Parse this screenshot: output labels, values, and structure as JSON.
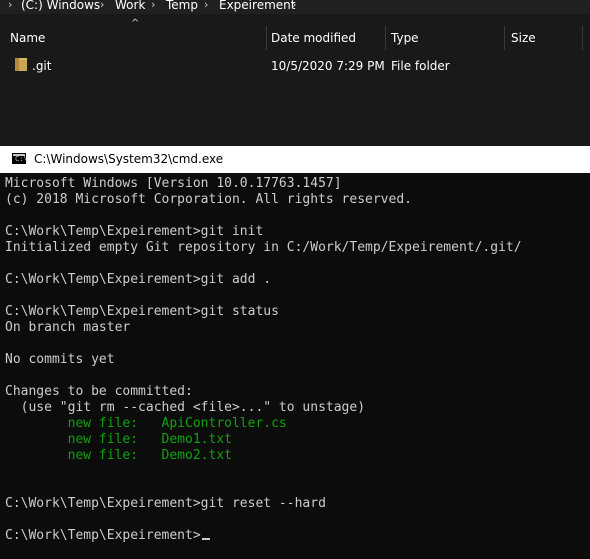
{
  "explorer": {
    "breadcrumb": [
      "(C:) Windows",
      "Work",
      "Temp",
      "Expeirement"
    ],
    "breadcrumb_separator": "›",
    "columns": {
      "name": "Name",
      "date_modified": "Date modified",
      "type": "Type",
      "size": "Size"
    },
    "sort_indicator": "^",
    "files": [
      {
        "name": ".git",
        "date_modified": "10/5/2020 7:29 PM",
        "type": "File folder",
        "size": "",
        "icon": "folder-icon"
      }
    ]
  },
  "cmd": {
    "title": "C:\\Windows\\System32\\cmd.exe",
    "icon_glyph": "C:\\",
    "lines": [
      "Microsoft Windows [Version 10.0.17763.1457]",
      "(c) 2018 Microsoft Corporation. All rights reserved.",
      "",
      "C:\\Work\\Temp\\Expeirement>git init",
      "Initialized empty Git repository in C:/Work/Temp/Expeirement/.git/",
      "",
      "C:\\Work\\Temp\\Expeirement>git add .",
      "",
      "C:\\Work\\Temp\\Expeirement>git status",
      "On branch master",
      "",
      "No commits yet",
      "",
      "Changes to be committed:",
      "  (use \"git rm --cached <file>...\" to unstage)",
      "        new file:   ApiController.cs",
      "        new file:   Demo1.txt",
      "        new file:   Demo2.txt",
      "",
      "",
      "C:\\Work\\Temp\\Expeirement>git reset --hard",
      "",
      "C:\\Work\\Temp\\Expeirement>"
    ],
    "green_line_indexes": [
      15,
      16,
      17
    ],
    "colors": {
      "background": "#0c0c0c",
      "text": "#cccccc",
      "staged": "#13a10e"
    }
  }
}
